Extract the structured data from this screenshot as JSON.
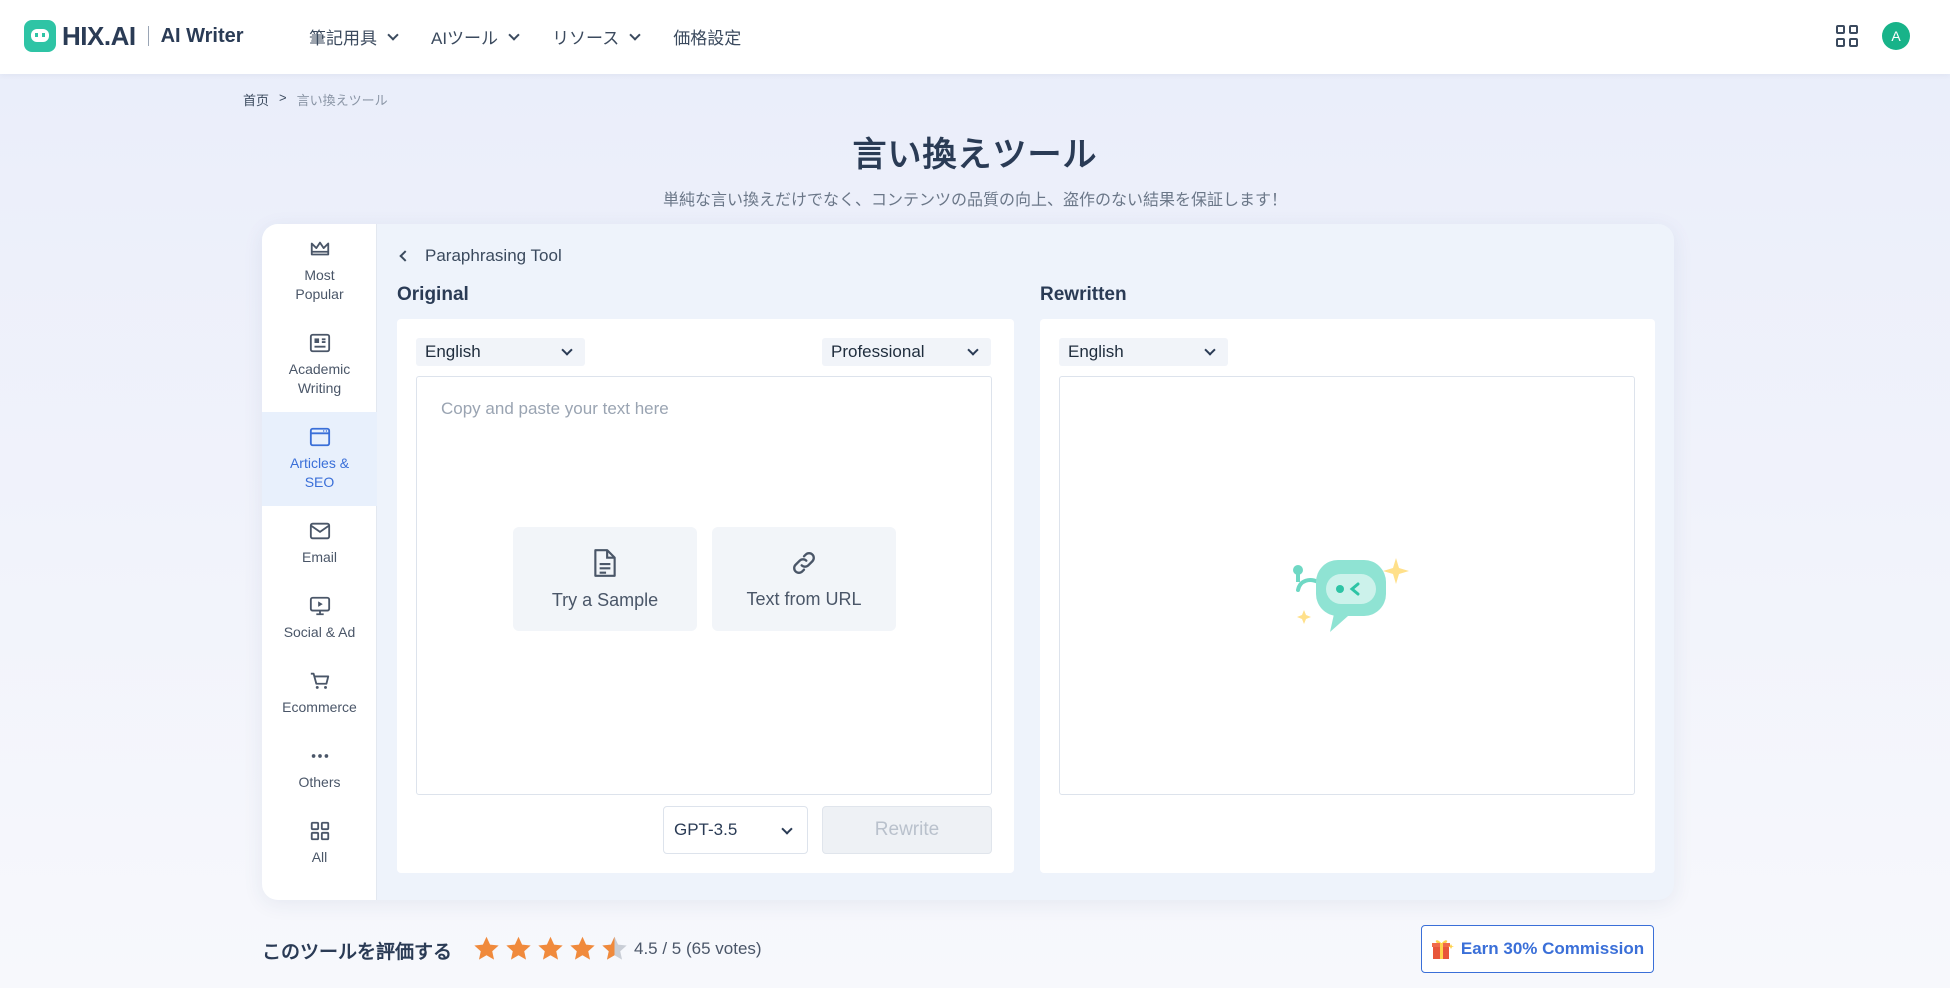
{
  "header": {
    "logo_text": "HIX.AI",
    "product_name": "AI Writer",
    "nav": [
      {
        "label": "筆記用具",
        "has_dropdown": true
      },
      {
        "label": "AIツール",
        "has_dropdown": true
      },
      {
        "label": "リソース",
        "has_dropdown": true
      },
      {
        "label": "価格設定",
        "has_dropdown": false
      }
    ],
    "avatar_initial": "A"
  },
  "breadcrumb": {
    "home": "首页",
    "separator": ">",
    "current": "言い換えツール"
  },
  "page": {
    "title": "言い換えツール",
    "subtitle": "単純な言い換えだけでなく、コンテンツの品質の向上、盗作のない結果を保証します！"
  },
  "sidebar": {
    "items": [
      {
        "label": "Most Popular",
        "icon": "crown-icon",
        "active": false
      },
      {
        "label": "Academic Writing",
        "icon": "newspaper-icon",
        "active": false
      },
      {
        "label": "Articles & SEO",
        "icon": "browser-icon",
        "active": true
      },
      {
        "label": "Email",
        "icon": "envelope-icon",
        "active": false
      },
      {
        "label": "Social & Ad",
        "icon": "monitor-play-icon",
        "active": false
      },
      {
        "label": "Ecommerce",
        "icon": "cart-icon",
        "active": false
      },
      {
        "label": "Others",
        "icon": "ellipsis-icon",
        "active": false
      },
      {
        "label": "All",
        "icon": "grid-icon",
        "active": false
      }
    ]
  },
  "tool": {
    "back_label": "Paraphrasing Tool",
    "original": {
      "label": "Original",
      "language": "English",
      "tone": "Professional",
      "placeholder": "Copy and paste your text here",
      "sample_button": "Try a Sample",
      "url_button": "Text from URL",
      "model": "GPT-3.5",
      "rewrite_button": "Rewrite"
    },
    "rewritten": {
      "label": "Rewritten",
      "language": "English"
    }
  },
  "rating": {
    "label": "このツールを評価する",
    "value_text": "4.5 / 5 (65 votes)",
    "stars": 4.5,
    "star_color": "#f08a3c"
  },
  "earn_button": "Earn 30% Commission",
  "colors": {
    "accent": "#3a6fd8",
    "brand": "#2ec4a5"
  }
}
